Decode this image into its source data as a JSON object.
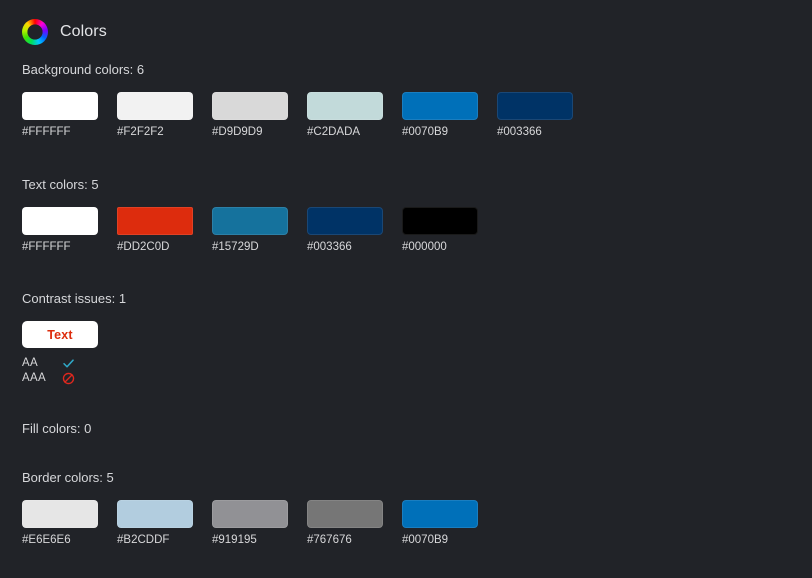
{
  "header": {
    "title": "Colors",
    "icon": "color-wheel-icon"
  },
  "theme": {
    "background": "#212328",
    "label_color": "#d6d7da",
    "hex_label_color": "#d8d8da",
    "pass_color": "#2FA8C7",
    "fail_color": "#E0281E"
  },
  "sections": [
    {
      "key": "background",
      "label": "Background colors: 6",
      "count": 6,
      "swatches": [
        {
          "hex": "#FFFFFF"
        },
        {
          "hex": "#F2F2F2"
        },
        {
          "hex": "#D9D9D9"
        },
        {
          "hex": "#C2DADA"
        },
        {
          "hex": "#0070B9"
        },
        {
          "hex": "#003366"
        }
      ]
    },
    {
      "key": "text",
      "label": "Text colors: 5",
      "count": 5,
      "swatches": [
        {
          "hex": "#FFFFFF"
        },
        {
          "hex": "#DD2C0D"
        },
        {
          "hex": "#15729D"
        },
        {
          "hex": "#003366"
        },
        {
          "hex": "#000000"
        }
      ]
    },
    {
      "key": "contrast",
      "label": "Contrast issues: 1",
      "count": 1,
      "issues": [
        {
          "sample_text": "Text",
          "foreground": "#DD2C0D",
          "background": "#FFFFFF",
          "levels": [
            {
              "name": "AA",
              "status": "pass",
              "icon": "check-icon"
            },
            {
              "name": "AAA",
              "status": "fail",
              "icon": "blocked-icon"
            }
          ]
        }
      ]
    },
    {
      "key": "fill",
      "label": "Fill colors: 0",
      "count": 0,
      "swatches": []
    },
    {
      "key": "border",
      "label": "Border colors: 5",
      "count": 5,
      "swatches": [
        {
          "hex": "#E6E6E6"
        },
        {
          "hex": "#B2CDDF"
        },
        {
          "hex": "#919195"
        },
        {
          "hex": "#767676"
        },
        {
          "hex": "#0070B9"
        }
      ]
    }
  ]
}
